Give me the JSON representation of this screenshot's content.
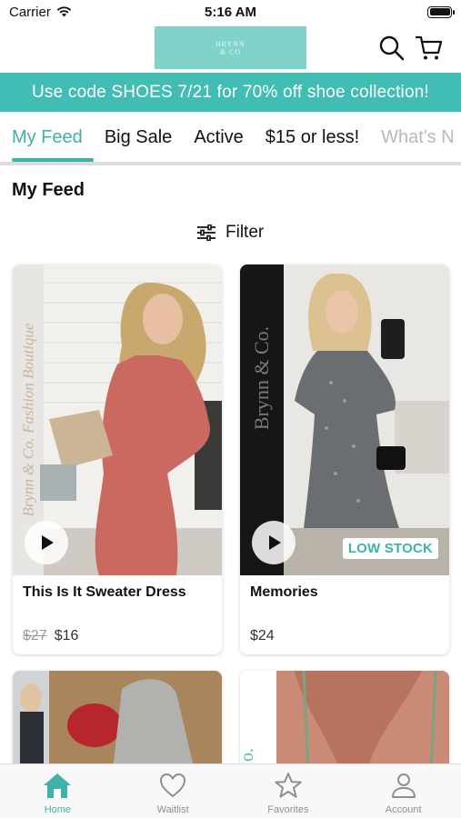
{
  "status_bar": {
    "carrier": "Carrier",
    "time": "5:16 AM"
  },
  "header": {
    "logo_text_line1": "BRYNN",
    "logo_text_line2": "& CO"
  },
  "promo": {
    "text": "Use code  SHOES 7/21 for 70% off shoe collection!"
  },
  "tabs": [
    {
      "label": "My Feed",
      "active": true
    },
    {
      "label": "Big Sale"
    },
    {
      "label": "Active"
    },
    {
      "label": "$15 or less!"
    },
    {
      "label": "What's N"
    }
  ],
  "feed": {
    "title": "My Feed",
    "filter_label": "Filter"
  },
  "products": [
    {
      "name": "This Is It Sweater Dress",
      "old_price": "$27",
      "price": "$16",
      "watermark": "Brynn & Co. Fashion Boutique"
    },
    {
      "name": "Memories",
      "price": "$24",
      "badge": "LOW STOCK",
      "watermark": "Brynn & Co."
    }
  ],
  "bottom_nav": [
    {
      "label": "Home",
      "icon": "home-icon",
      "active": true
    },
    {
      "label": "Waitlist",
      "icon": "heart-icon"
    },
    {
      "label": "Favorites",
      "icon": "star-icon"
    },
    {
      "label": "Account",
      "icon": "person-icon"
    }
  ],
  "colors": {
    "accent": "#3fb2a8",
    "banner": "#42bdb3",
    "logo_bg": "#7fd3c9"
  }
}
